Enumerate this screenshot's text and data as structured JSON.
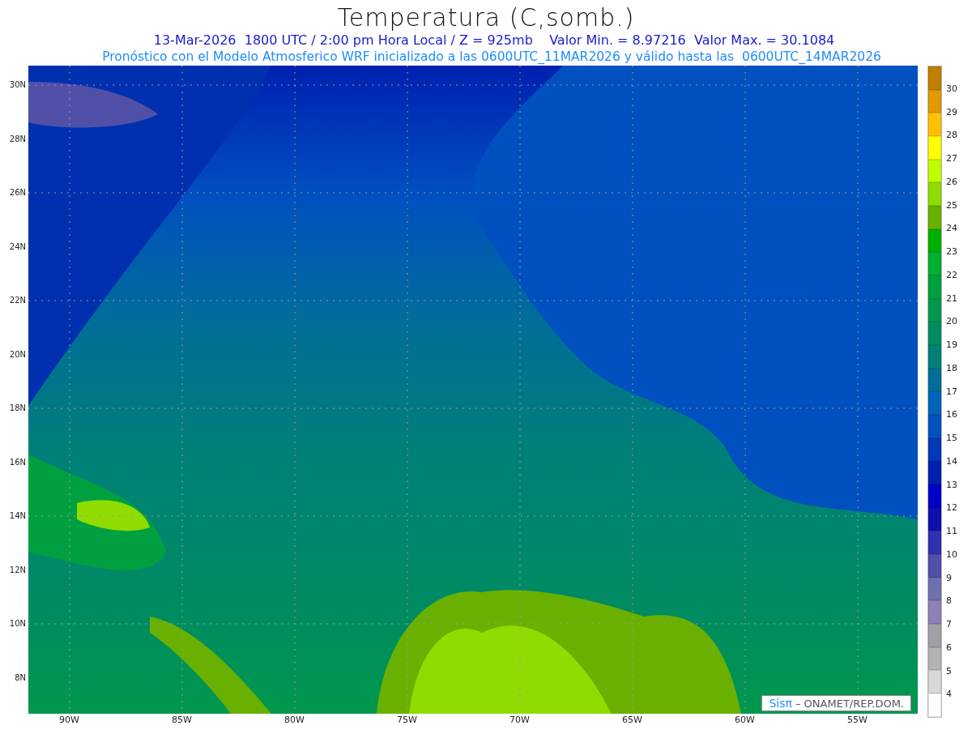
{
  "title": "Temperatura (C,somb.)",
  "subtitle": "13-Mar-2026  1800 UTC / 2:00 pm Hora Local / Z = 925mb    Valor Min. = 8.97216  Valor Max. = 30.1084",
  "forecast_note": "Pronóstico con el Modelo Atmosferico WRF inicializado a las 0600UTC_11MAR2026 y válido hasta las  0600UTC_14MAR2026",
  "map": {
    "lat_labels": [
      "30N",
      "28N",
      "26N",
      "24N",
      "22N",
      "20N",
      "18N",
      "16N",
      "14N",
      "12N",
      "10N",
      "8N"
    ],
    "lon_labels": [
      "90W",
      "85W",
      "80W",
      "75W",
      "70W",
      "65W",
      "60W",
      "55W"
    ],
    "logo": {
      "mark": "Sisπ",
      "credit": "– ONAMET/REP.DOM."
    }
  },
  "colorbar": {
    "bins": [
      {
        "color": "#bf7f00"
      },
      {
        "color": "#e09a00",
        "label": "30"
      },
      {
        "color": "#ffc000",
        "label": "29"
      },
      {
        "color": "#ffff00",
        "label": "28"
      },
      {
        "color": "#c0ff00",
        "label": "27"
      },
      {
        "color": "#90dc00",
        "label": "26"
      },
      {
        "color": "#6ab000",
        "label": "25"
      },
      {
        "color": "#00b000",
        "label": "24"
      },
      {
        "color": "#00b030",
        "label": "23"
      },
      {
        "color": "#00a040",
        "label": "22"
      },
      {
        "color": "#00984c",
        "label": "21"
      },
      {
        "color": "#008c60",
        "label": "20"
      },
      {
        "color": "#008078",
        "label": "19"
      },
      {
        "color": "#006e98",
        "label": "18"
      },
      {
        "color": "#0064b8",
        "label": "17"
      },
      {
        "color": "#0050c0",
        "label": "16"
      },
      {
        "color": "#0038b8",
        "label": "15"
      },
      {
        "color": "#0020b0",
        "label": "14"
      },
      {
        "color": "#0000c8",
        "label": "13"
      },
      {
        "color": "#1010b0",
        "label": "12"
      },
      {
        "color": "#3030b0",
        "label": "11"
      },
      {
        "color": "#5050a8",
        "label": "10"
      },
      {
        "color": "#7070b0",
        "label": "9"
      },
      {
        "color": "#9080b8",
        "label": "8"
      },
      {
        "color": "#a0a0a8",
        "label": "7"
      },
      {
        "color": "#b4b4b4",
        "label": "6"
      },
      {
        "color": "#d8d8d8",
        "label": "5"
      },
      {
        "color": "#ffffff",
        "label": "4"
      }
    ]
  }
}
